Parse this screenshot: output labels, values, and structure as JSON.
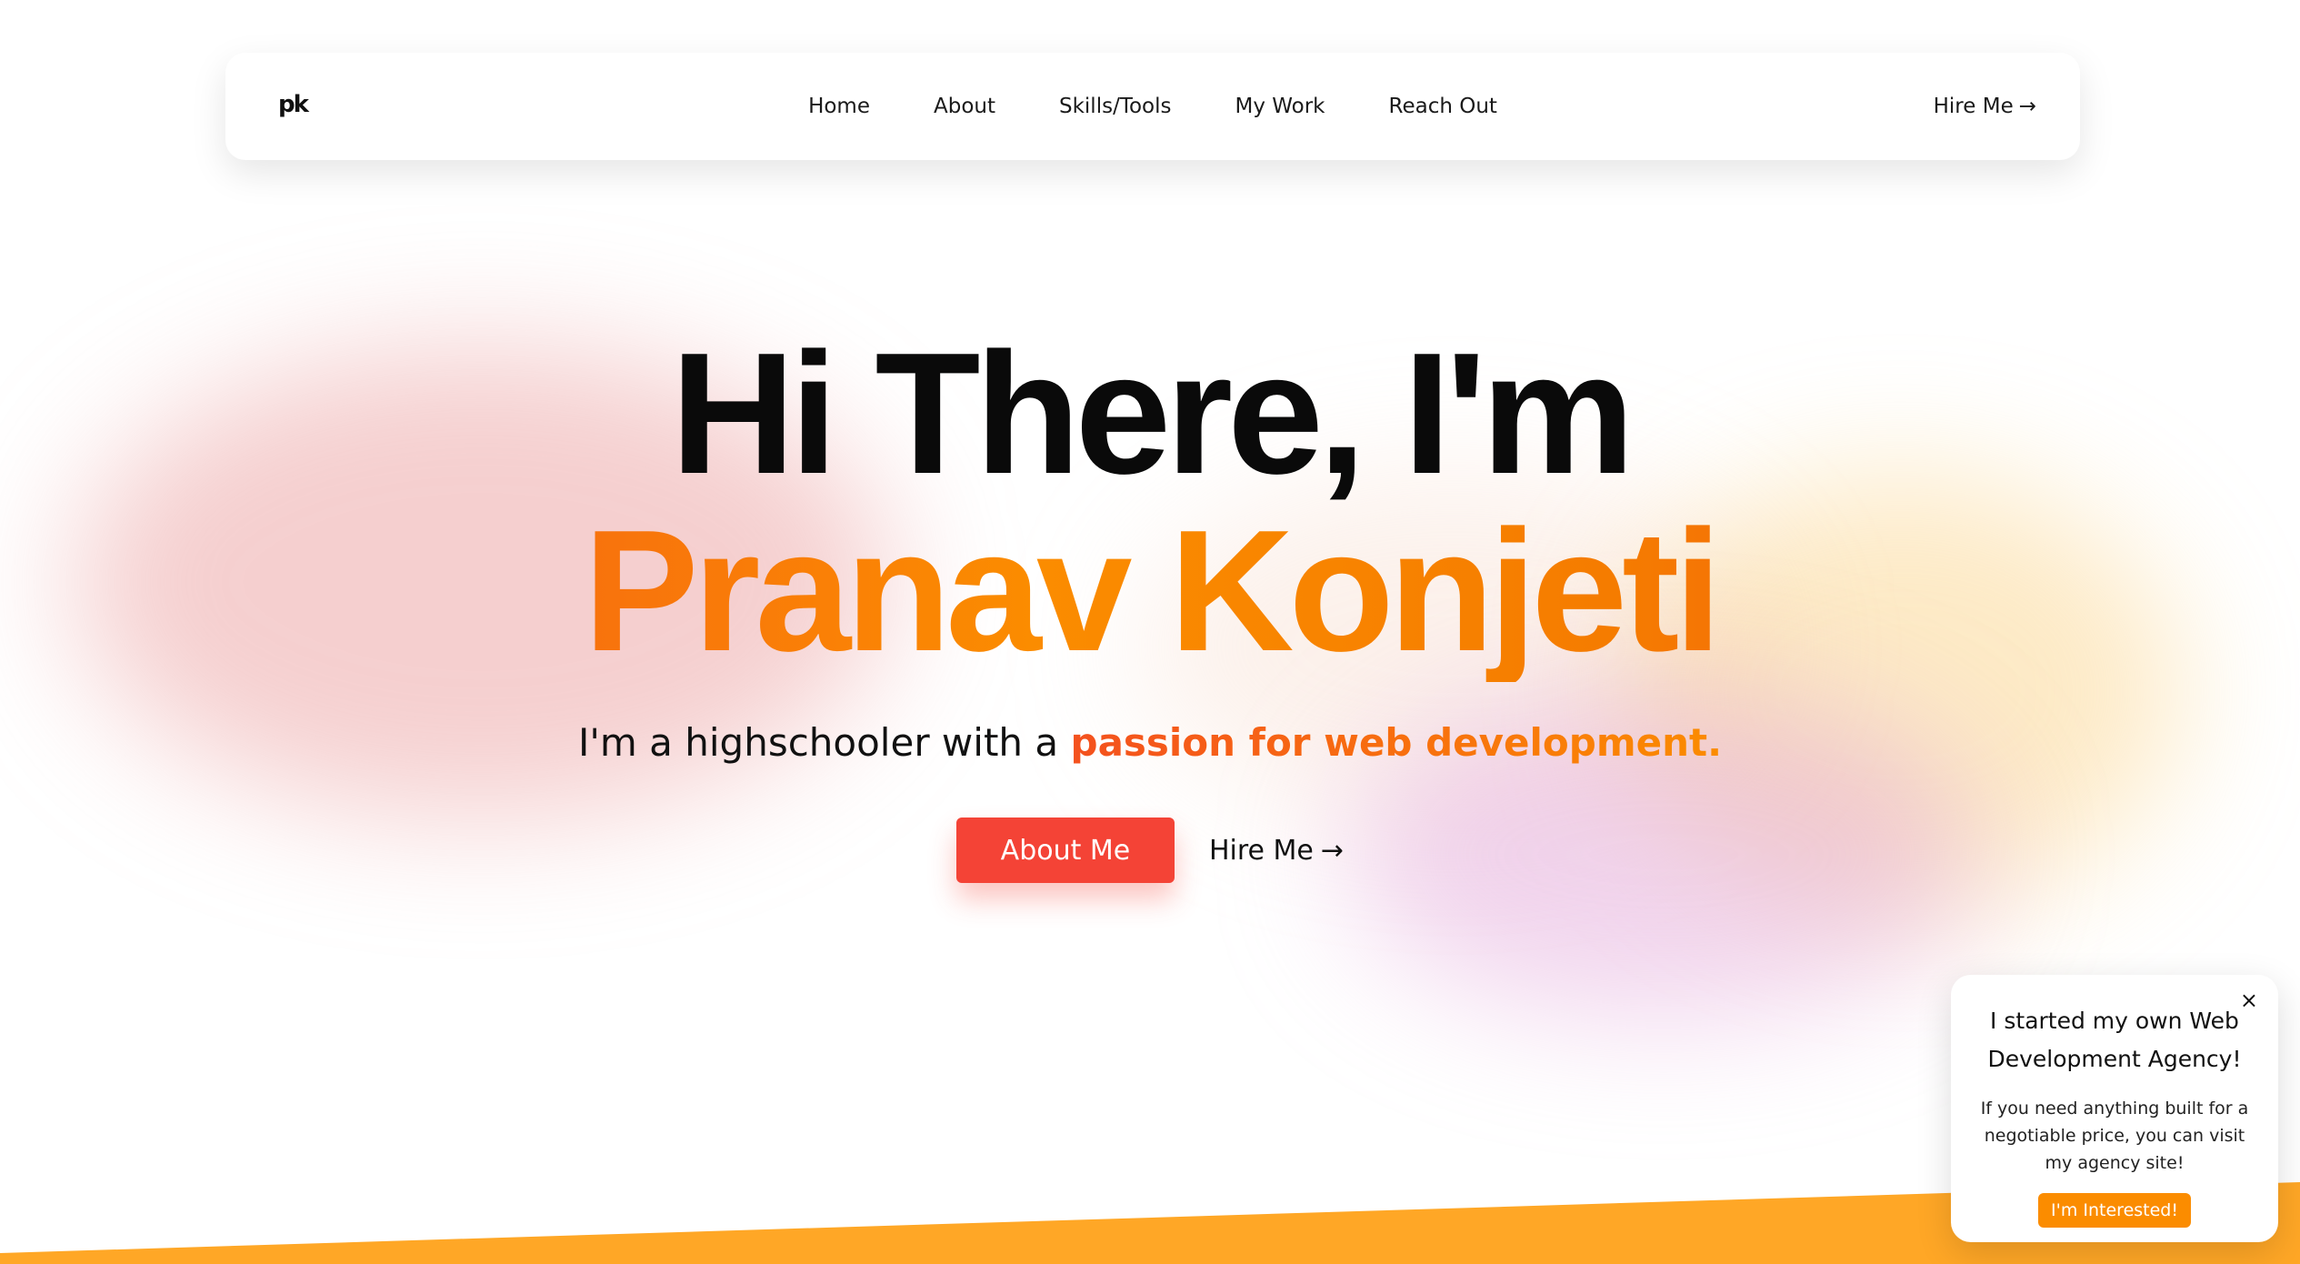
{
  "nav": {
    "logo": "pk",
    "links": [
      "Home",
      "About",
      "Skills/Tools",
      "My Work",
      "Reach Out"
    ],
    "hire_label": "Hire Me",
    "hire_arrow": "→"
  },
  "hero": {
    "greeting": "Hi There, I'm",
    "name": "Pranav Konjeti",
    "subtitle_prefix": "I'm a highschooler with a",
    "subtitle_accent": "passion for web development.",
    "about_button": "About Me",
    "hire_label": "Hire Me",
    "hire_arrow": "→"
  },
  "popup": {
    "close": "×",
    "title": "I started my own Web Development Agency!",
    "body": "If you need anything built for a negotiable price, you can visit my agency site!",
    "button": "I'm Interested!"
  },
  "colors": {
    "accent_red": "#f44336",
    "accent_orange": "#fb8c00",
    "band": "#ffa726"
  },
  "icons": {
    "hire_arrow": "right-arrow-icon",
    "close": "close-icon"
  }
}
